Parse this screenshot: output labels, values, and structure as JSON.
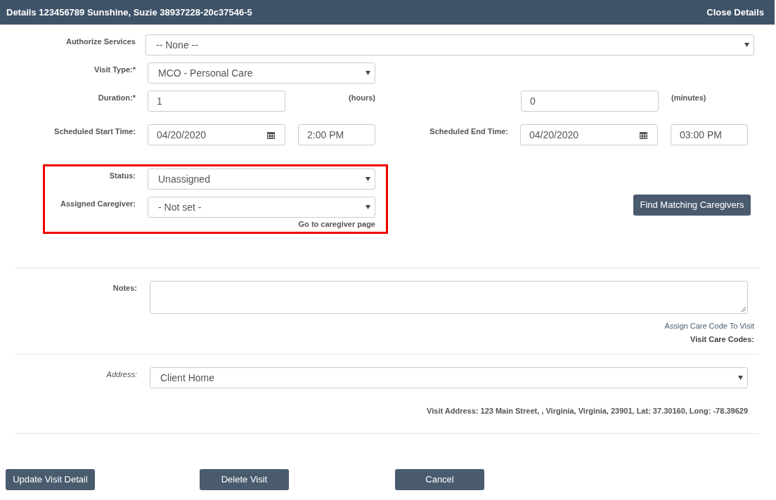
{
  "header": {
    "title": "Details 123456789 Sunshine, Suzie 38937228-20c37546-5",
    "close": "Close Details"
  },
  "authorize_services": {
    "label": "Authorize Services",
    "value": "-- None --"
  },
  "visit_type": {
    "label": "Visit Type:*",
    "value": "MCO - Personal Care"
  },
  "duration": {
    "label": "Duration:*",
    "hours": "1",
    "hours_unit": "(hours)",
    "minutes": "0",
    "minutes_unit": "(minutes)"
  },
  "start": {
    "label": "Scheduled Start Time:",
    "date": "04/20/2020",
    "time": "2:00 PM"
  },
  "end": {
    "label": "Scheduled End Time:",
    "date": "04/20/2020",
    "time": "03:00 PM"
  },
  "assignment": {
    "highlighted": true,
    "status_label": "Status:",
    "status": "Unassigned",
    "caregiver_label": "Assigned Caregiver:",
    "caregiver": "- Not set -",
    "caregiver_link": "Go to caregiver page",
    "find_button": "Find Matching Caregivers"
  },
  "notes": {
    "label": "Notes:",
    "assign_link": "Assign Care Code To Visit",
    "care_codes_label": "Visit Care Codes:"
  },
  "address": {
    "label": "Address:",
    "value": "Client Home",
    "details": "Visit Address: 123 Main Street, , Virginia, Virginia, 23901, Lat: 37.30160, Long: -78.39629"
  },
  "buttons": [
    "Update Visit Detail",
    "Delete Visit",
    "Cancel"
  ]
}
